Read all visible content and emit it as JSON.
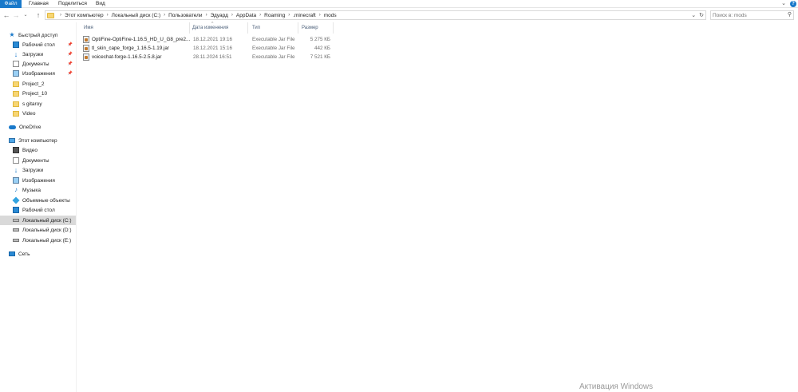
{
  "ribbon": {
    "tabs": [
      "Файл",
      "Главная",
      "Поделиться",
      "Вид"
    ],
    "help_label": "?"
  },
  "nav": {
    "back_icon": "arrow-left-icon",
    "forward_icon": "arrow-right-icon",
    "recent_icon": "chevron-down-icon",
    "up_icon": "arrow-up-icon"
  },
  "address": {
    "breadcrumbs": [
      "Этот компьютер",
      "Локальный диск (C:)",
      "Пользователи",
      "Эдуард",
      "AppData",
      "Roaming",
      ".minecraft",
      "mods"
    ]
  },
  "search": {
    "placeholder": "Поиск в: mods"
  },
  "sidebar": {
    "quick_access": "Быстрый доступ",
    "quick_items": [
      {
        "label": "Рабочий стол",
        "icon": "desktop-icon",
        "pinned": true
      },
      {
        "label": "Загрузки",
        "icon": "downloads-icon",
        "pinned": true
      },
      {
        "label": "Документы",
        "icon": "documents-icon",
        "pinned": true
      },
      {
        "label": "Изображения",
        "icon": "pictures-icon",
        "pinned": true
      },
      {
        "label": "Project_2",
        "icon": "folder-icon",
        "pinned": false
      },
      {
        "label": "Project_10",
        "icon": "folder-icon",
        "pinned": false
      },
      {
        "label": "s gitaroy",
        "icon": "folder-icon",
        "pinned": false
      },
      {
        "label": "Video",
        "icon": "folder-icon",
        "pinned": false
      }
    ],
    "onedrive": "OneDrive",
    "this_pc": "Этот компьютер",
    "pc_items": [
      {
        "label": "Видео",
        "icon": "video-icon"
      },
      {
        "label": "Документы",
        "icon": "documents-icon"
      },
      {
        "label": "Загрузки",
        "icon": "downloads-icon"
      },
      {
        "label": "Изображения",
        "icon": "pictures-icon"
      },
      {
        "label": "Музыка",
        "icon": "music-icon"
      },
      {
        "label": "Объемные объекты",
        "icon": "3d-objects-icon"
      },
      {
        "label": "Рабочий стол",
        "icon": "desktop-icon"
      },
      {
        "label": "Локальный диск (C:)",
        "icon": "drive-icon",
        "selected": true
      },
      {
        "label": "Локальный диск (D:)",
        "icon": "drive-icon"
      },
      {
        "label": "Локальный диск (E:)",
        "icon": "drive-icon"
      }
    ],
    "network": "Сеть"
  },
  "file_list": {
    "columns": [
      "Имя",
      "Дата изменения",
      "Тип",
      "Размер"
    ],
    "rows": [
      {
        "name": "OptiFine-OptiFine-1.16.5_HD_U_G8_pre2...",
        "date": "18.12.2021 19:16",
        "type": "Executable Jar File",
        "size": "5 275 КБ"
      },
      {
        "name": "tl_skin_cape_forge_1.16.5-1.19.jar",
        "date": "18.12.2021 15:16",
        "type": "Executable Jar File",
        "size": "442 КБ"
      },
      {
        "name": "voicechat-forge-1.16.5-2.5.8.jar",
        "date": "28.11.2024 16:51",
        "type": "Executable Jar File",
        "size": "7 521 КБ"
      }
    ]
  },
  "watermark": "Активация Windows"
}
